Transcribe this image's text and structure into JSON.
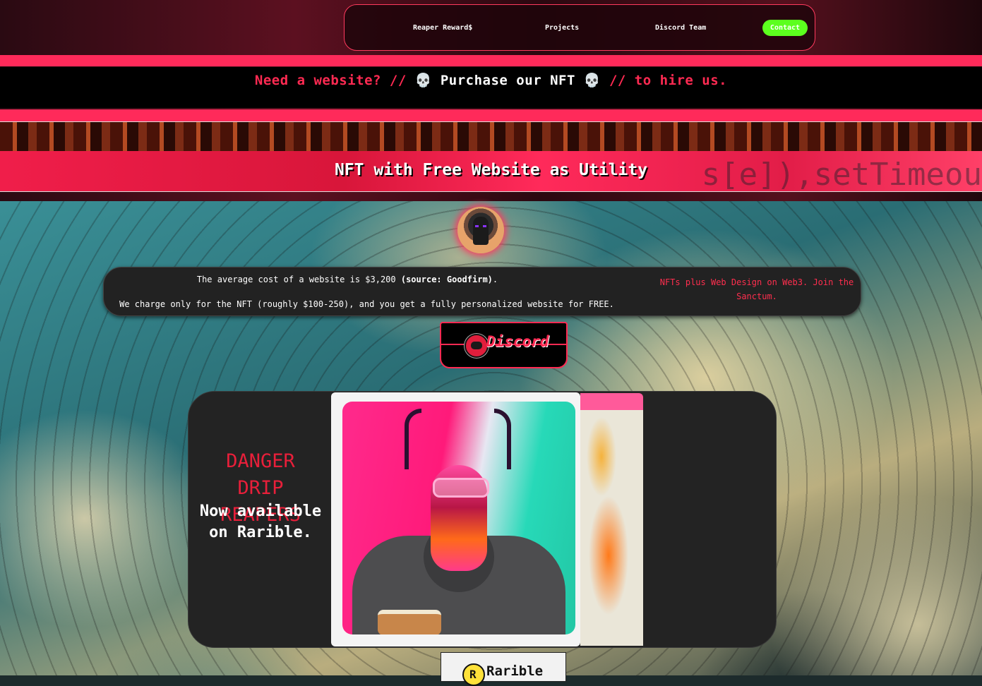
{
  "nav": {
    "items": [
      "Reaper Reward$",
      "Projects",
      "Discord Team"
    ],
    "contact": "Contact"
  },
  "banner": {
    "part1": "Need a website? //",
    "skull": "💀",
    "part2": "Purchase our NFT",
    "part3": "// to hire us."
  },
  "headline": "NFT with Free Website as Utility",
  "info": {
    "line1_prefix": "The average cost of a website is $3,200",
    "line1_source": "(source: Goodfirm)",
    "line1_suffix": ".",
    "line2": "We charge only for the NFT (roughly $100-250), and you get a fully personalized website for FREE.",
    "side": "NFTs plus Web Design on Web3. Join the Sanctum."
  },
  "discord_button": "Discord",
  "collection": {
    "title": "DANGER DRIP REAPERS",
    "subtitle": "Now available on Rarible."
  },
  "rarible_button": "Rarible",
  "colors": {
    "accent": "#ff2a52",
    "contact": "#5cff1e",
    "card": "#232323"
  }
}
